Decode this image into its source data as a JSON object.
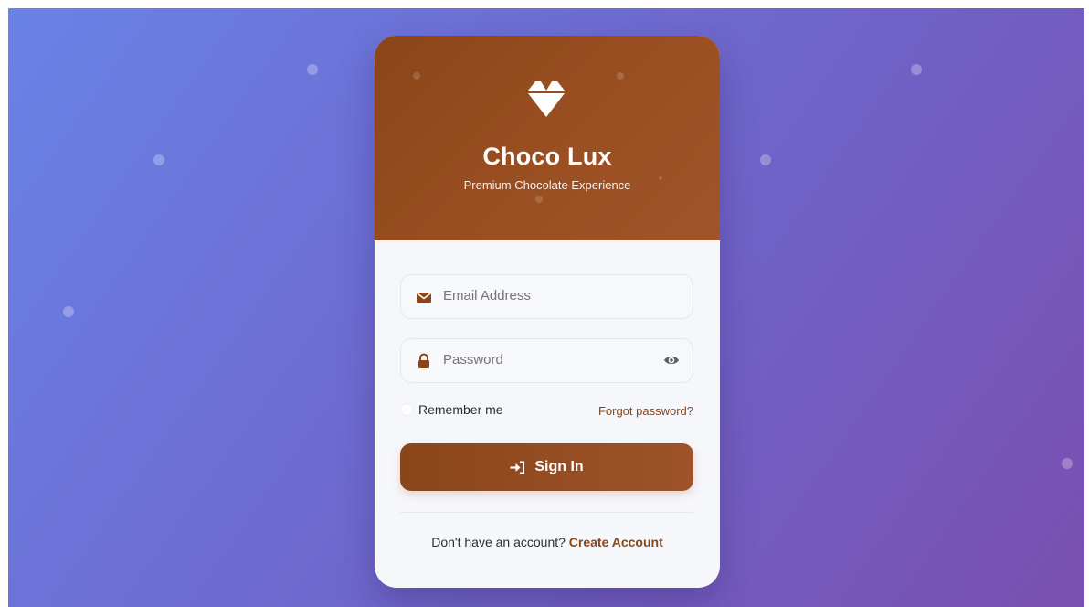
{
  "brand": {
    "name": "Choco Lux",
    "tagline": "Premium Chocolate Experience",
    "logo_icon": "diamond-icon"
  },
  "form": {
    "email": {
      "placeholder": "Email Address",
      "icon": "envelope-icon"
    },
    "password": {
      "placeholder": "Password",
      "icon": "lock-icon",
      "toggle_icon": "eye-icon"
    },
    "remember_label": "Remember me",
    "forgot_label": "Forgot password?",
    "signin_label": "Sign In",
    "signin_icon": "sign-in-icon"
  },
  "footer": {
    "prompt": "Don't have an account?",
    "link_label": "Create Account"
  },
  "colors": {
    "brand_brown": "#8a4519",
    "background_start": "#6a82e6",
    "background_end": "#7a4fb0"
  }
}
